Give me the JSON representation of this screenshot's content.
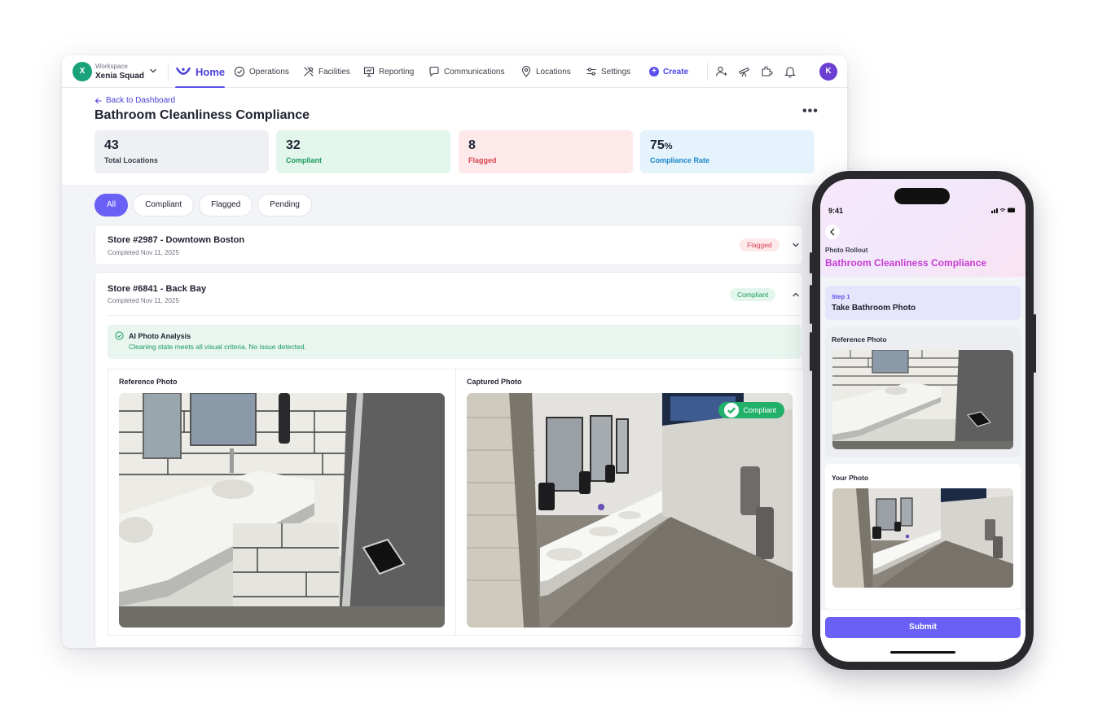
{
  "workspace": {
    "label": "Workspace",
    "name": "Xenia Squad",
    "initial": "X"
  },
  "nav": {
    "home": "Home",
    "items": [
      "Operations",
      "Facilities",
      "Reporting",
      "Communications",
      "Locations",
      "Settings"
    ],
    "create": "Create",
    "user_initial": "K"
  },
  "header": {
    "back": "Back to Dashboard",
    "title": "Bathroom Cleanliness Compliance",
    "more": "•••"
  },
  "stats": [
    {
      "value": "43",
      "label": "Total Locations",
      "color": "#eef0f4",
      "text_color": "#1f2230",
      "label_color": "#3a3d4a"
    },
    {
      "value": "32",
      "label": "Compliant",
      "color": "#e3f6ec",
      "text_color": "#1f2230",
      "label_color": "#1a9a5e"
    },
    {
      "value": "8",
      "label": "Flagged",
      "color": "#fde8ea",
      "text_color": "#1f2230",
      "label_color": "#d64550"
    },
    {
      "value": "75",
      "unit": "%",
      "label": "Compliance Rate",
      "color": "#e4f3fc",
      "text_color": "#1f2230",
      "label_color": "#1a86c7"
    }
  ],
  "filters": [
    "All",
    "Compliant",
    "Flagged",
    "Pending"
  ],
  "stores": [
    {
      "name": "Store #2987 - Downtown Boston",
      "completed": "Completed Nov 11, 2025",
      "status": "Flagged"
    },
    {
      "name": "Store #6841 - Back Bay",
      "completed": "Completed Nov 11, 2025",
      "status": "Compliant"
    }
  ],
  "ai": {
    "title": "AI Photo Analysis",
    "message": "Cleaning state meets all visual criteria. No issue detected."
  },
  "photos": {
    "reference_label": "Reference Photo",
    "captured_label": "Captured Photo",
    "captured_badge": "Compliant"
  },
  "phone": {
    "time": "9:41",
    "kicker": "Photo Rollout",
    "title": "Bathroom Cleanliness Compliance",
    "step_kicker": "Step 1",
    "step_title": "Take Bathroom Photo",
    "reference_label": "Reference Photo",
    "your_label": "Your Photo",
    "submit": "Submit"
  },
  "colors": {
    "accent": "#6a60f5",
    "brand": "#4b3fd6",
    "success": "#22b06a",
    "danger": "#d64550"
  }
}
